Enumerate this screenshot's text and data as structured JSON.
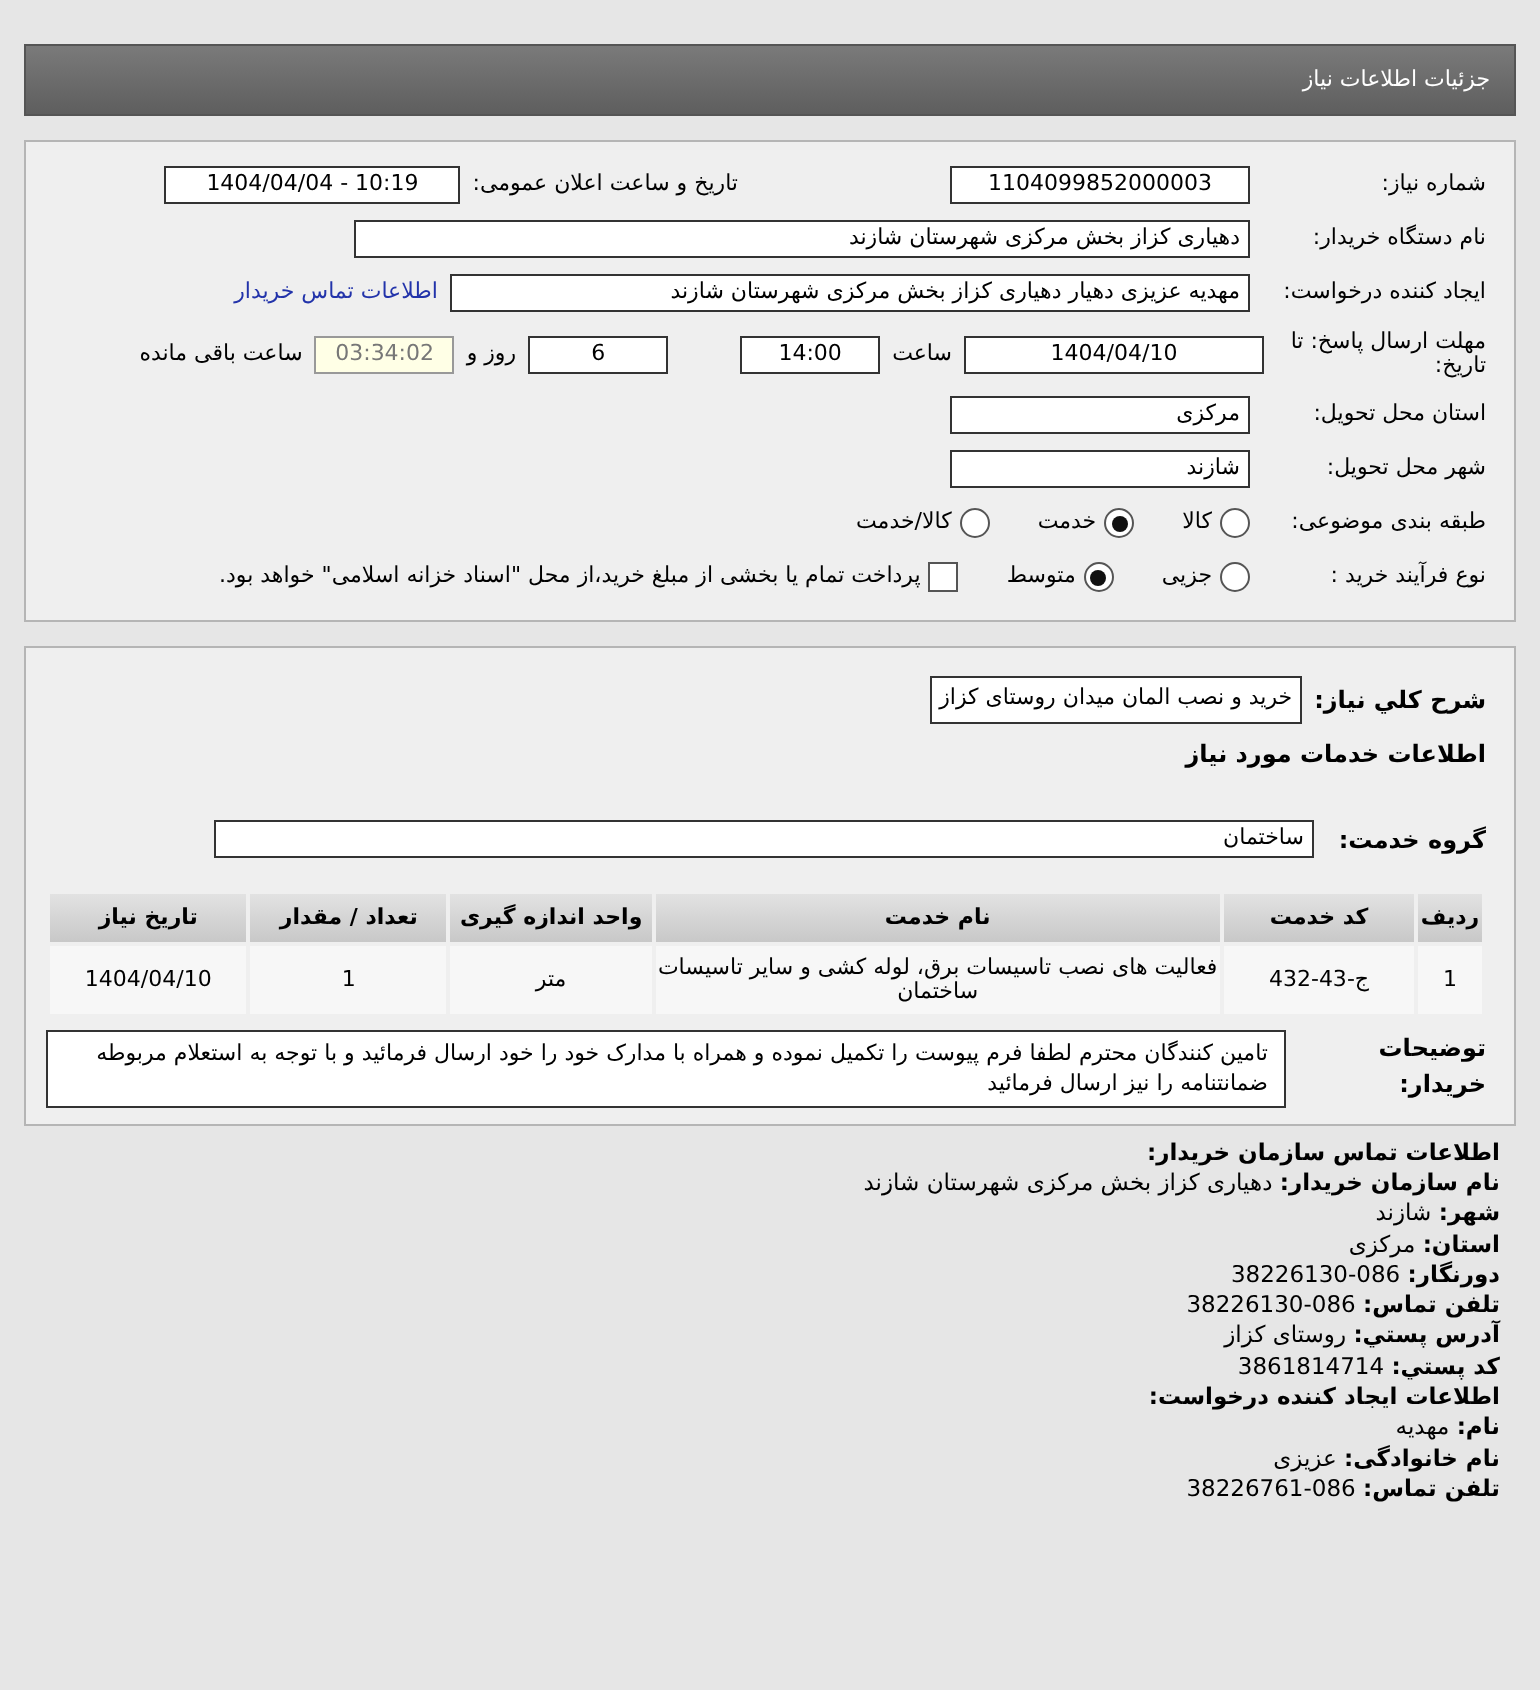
{
  "header": {
    "title": "جزئیات اطلاعات نیاز"
  },
  "details": {
    "need_number": {
      "label": "شماره نیاز:",
      "value": "1104099852000003"
    },
    "announce": {
      "label": "تاریخ و ساعت اعلان عمومی:",
      "value": "1404/04/04 - 10:19"
    },
    "buyer": {
      "label": "نام دستگاه خریدار:",
      "value": "دهیاری کزاز بخش مرکزی شهرستان شازند"
    },
    "creator": {
      "label": "ایجاد کننده درخواست:",
      "value": "مهدیه عزیزی دهیار دهیاری کزاز بخش مرکزی شهرستان شازند",
      "link": "اطلاعات تماس خریدار"
    },
    "deadline": {
      "label": "مهلت ارسال پاسخ: تا تاریخ:",
      "date": "1404/04/10",
      "time_label": "ساعت",
      "time": "14:00",
      "days": "6",
      "days_label": "روز و",
      "remaining": "03:34:02",
      "remaining_label": "ساعت باقی مانده"
    },
    "province": {
      "label": "استان محل تحویل:",
      "value": "مرکزی"
    },
    "city": {
      "label": "شهر محل تحویل:",
      "value": "شازند"
    },
    "category": {
      "label": "طبقه بندی موضوعی:",
      "options": [
        {
          "label": "کالا",
          "selected": false
        },
        {
          "label": "خدمت",
          "selected": true
        },
        {
          "label": "کالا/خدمت",
          "selected": false
        }
      ]
    },
    "process": {
      "label": "نوع فرآیند خرید :",
      "options": [
        {
          "label": "جزیی",
          "selected": false
        },
        {
          "label": "متوسط",
          "selected": true
        }
      ],
      "payment": {
        "label": "پرداخت تمام یا بخشی از مبلغ خرید،از محل \"اسناد خزانه اسلامی\" خواهد بود.",
        "checked": false
      }
    }
  },
  "summary": {
    "label": "شرح کلي نياز:",
    "value": "خرید و نصب المان میدان روستای کزاز",
    "services_title": "اطلاعات خدمات مورد نیاز",
    "group": {
      "label": "گروه خدمت:",
      "value": "ساختمان"
    },
    "table": {
      "columns": [
        "ردیف",
        "کد خدمت",
        "نام خدمت",
        "واحد اندازه گیری",
        "تعداد / مقدار",
        "تاریخ نیاز"
      ],
      "rows": [
        [
          "1",
          "ج-43-432",
          "فعالیت های نصب تاسیسات برق، لوله کشی و سایر تاسیسات ساختمان",
          "متر",
          "1",
          "1404/04/10"
        ]
      ]
    },
    "notes": {
      "label": "توضیحات خریدار:",
      "value": "تامین کنندگان محترم لطفا فرم پیوست را تکمیل نموده و همراه با مدارک خود را خود ارسال فرمائید و با توجه به استعلام مربوطه ضمانتنامه را نیز ارسال فرمائید"
    }
  },
  "contact": [
    {
      "kind": "heading",
      "text": "اطلاعات تماس سازمان خریدار:"
    },
    {
      "kind": "line",
      "text": "**نام سازمان خریدار:** دهیاری کزاز بخش مرکزی شهرستان شازند"
    },
    {
      "kind": "line",
      "text": "**شهر:** شازند"
    },
    {
      "kind": "line",
      "text": "**استان:** مرکزی"
    },
    {
      "kind": "line",
      "text": "**دورنگار:** 086-38226130"
    },
    {
      "kind": "line",
      "text": "**تلفن تماس:** 086-38226130"
    },
    {
      "kind": "line",
      "text": "**آدرس پستي:** روستای کزاز"
    },
    {
      "kind": "line",
      "text": "**کد پستي:** 3861814714"
    },
    {
      "kind": "heading",
      "text": "اطلاعات ایجاد کننده درخواست:"
    },
    {
      "kind": "line",
      "text": "**نام:** مهدیه"
    },
    {
      "kind": "line",
      "text": "**نام خانوادگی:** عزیزی"
    },
    {
      "kind": "line",
      "text": "**تلفن تماس:** 086-38226761"
    }
  ]
}
